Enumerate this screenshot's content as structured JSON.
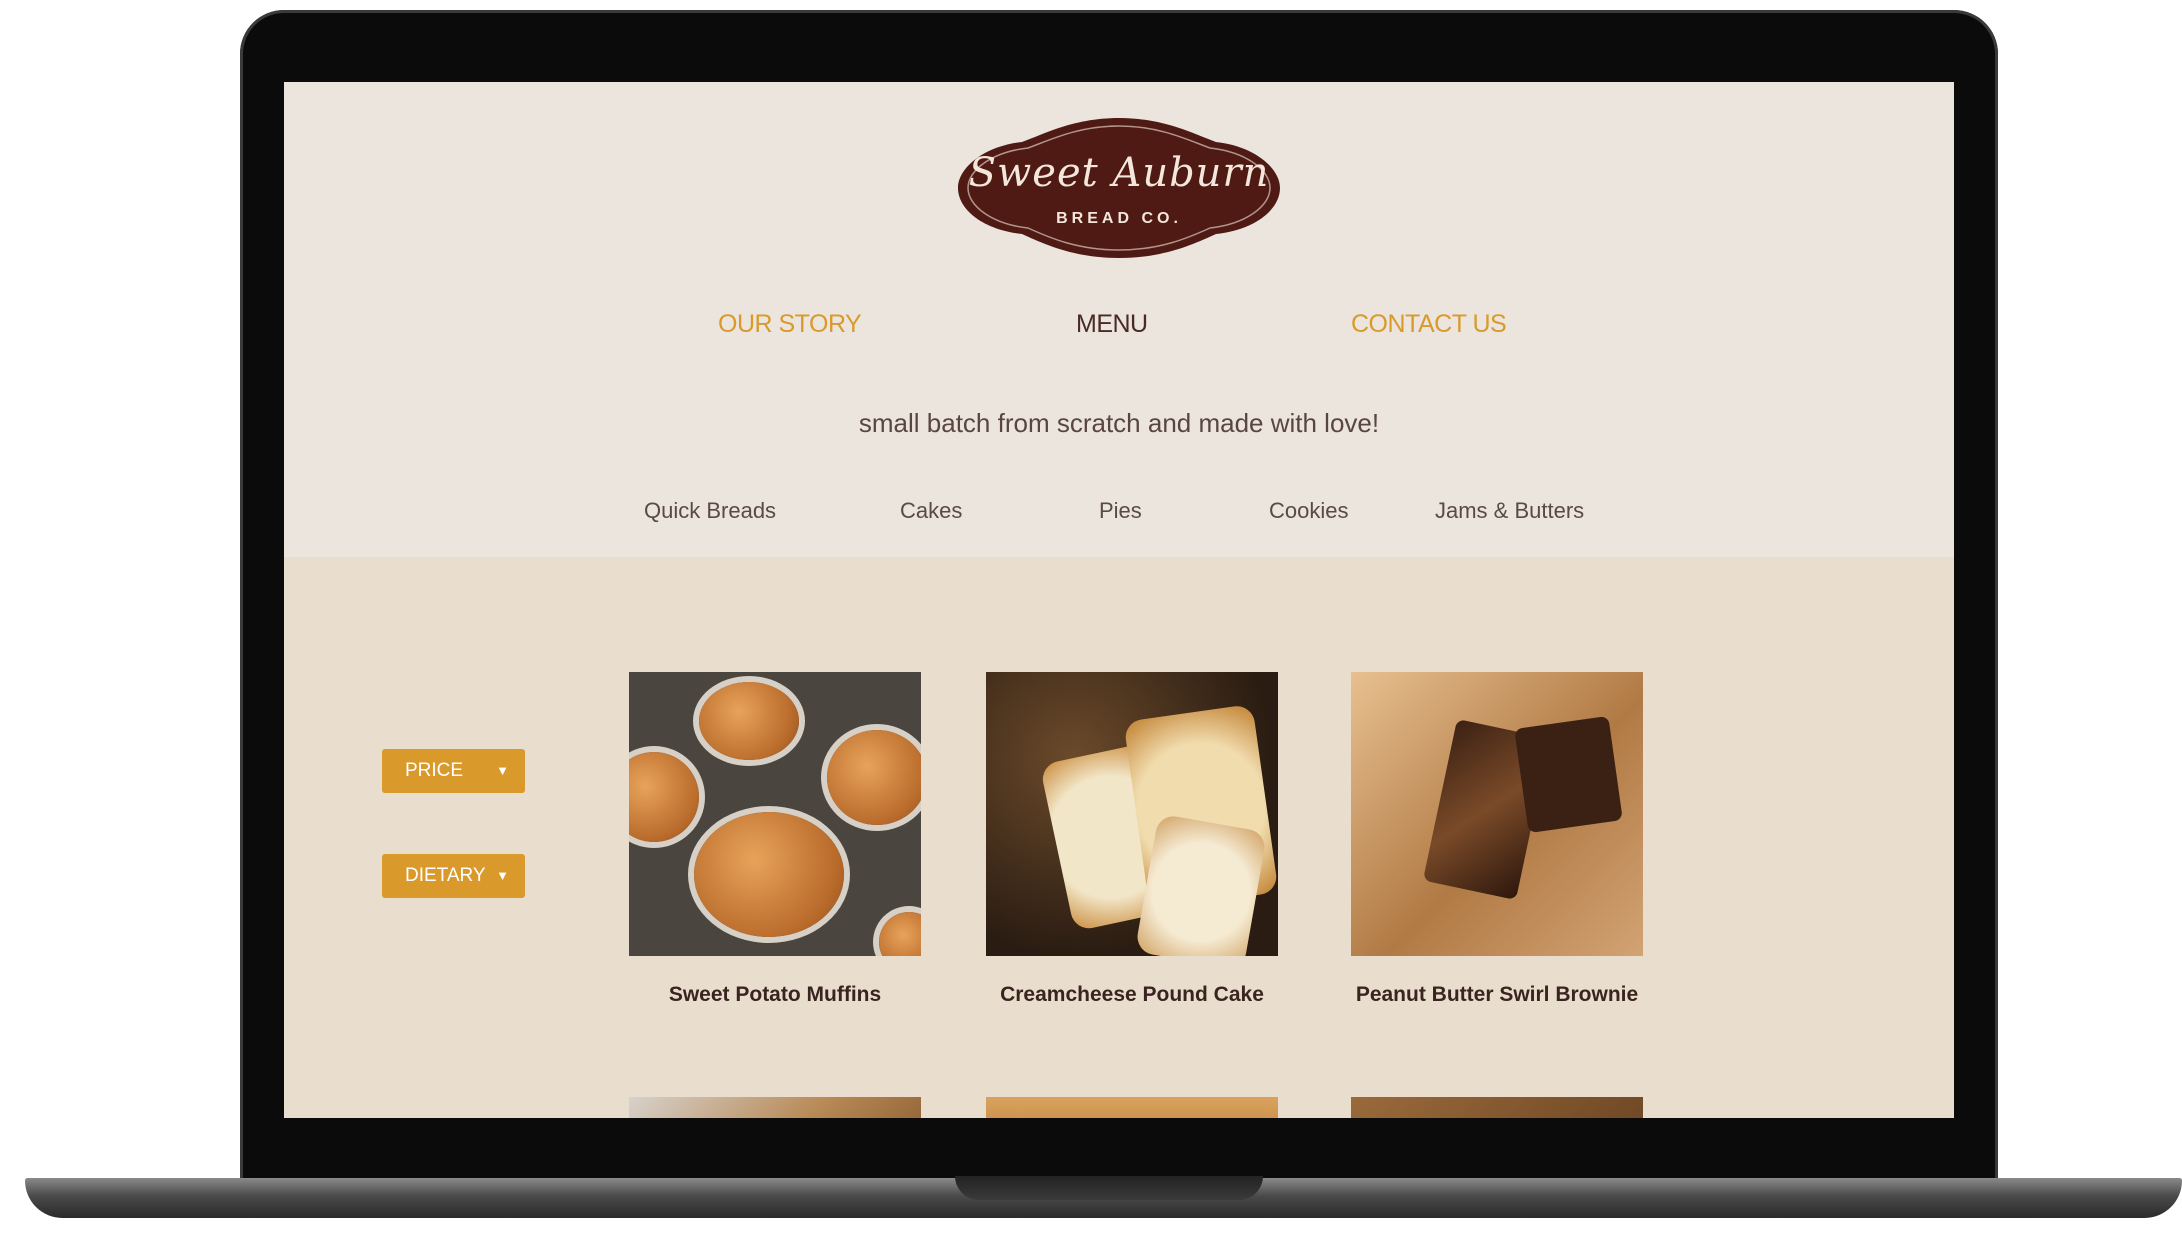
{
  "brand": {
    "script_name": "Sweet Auburn",
    "sub_name": "BREAD CO.",
    "colors": {
      "maroon": "#4f1a14",
      "gold": "#d99a2b",
      "cream": "#ebe5de",
      "band": "#e9dece"
    }
  },
  "nav": {
    "items": [
      {
        "label": "OUR STORY",
        "active": false
      },
      {
        "label": "MENU",
        "active": true
      },
      {
        "label": "CONTACT US",
        "active": false
      }
    ]
  },
  "tagline": "small batch from scratch and made with love!",
  "categories": [
    "Quick Breads",
    "Cakes",
    "Pies",
    "Cookies",
    "Jams & Butters"
  ],
  "filters": [
    {
      "label": "PRICE",
      "icon": "chevron-down-icon"
    },
    {
      "label": "DIETARY",
      "icon": "chevron-down-icon"
    }
  ],
  "products": [
    {
      "name": "Sweet Potato Muffins"
    },
    {
      "name": "Creamcheese Pound Cake"
    },
    {
      "name": "Peanut Butter Swirl Brownie"
    }
  ]
}
